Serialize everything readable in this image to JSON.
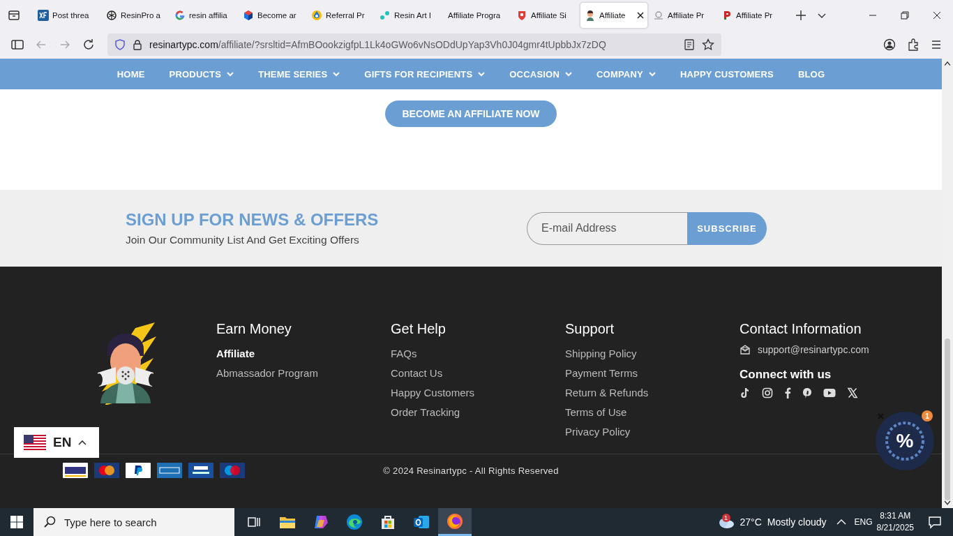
{
  "browser": {
    "tabs": [
      {
        "label": "Post threa",
        "selected": false
      },
      {
        "label": "ResinPro a",
        "selected": false
      },
      {
        "label": "resin affilia",
        "selected": false
      },
      {
        "label": "Become ar",
        "selected": false
      },
      {
        "label": "Referral Pr",
        "selected": false
      },
      {
        "label": "Resin Art I",
        "selected": false
      },
      {
        "label": "Affiliate Progra",
        "selected": false
      },
      {
        "label": "Affiliate Si",
        "selected": false
      },
      {
        "label": "Affiliate",
        "selected": true
      },
      {
        "label": "Affiliate Pr",
        "selected": false
      },
      {
        "label": "Affiliate Pr",
        "selected": false
      }
    ],
    "url_host": "resinartypc.com",
    "url_path": "/affiliate/?srsltid=AfmBOookzigfpL1Lk4oGWo6vNsODdUpYap3Vh0J04gmr4tUpbbJx7zDQ"
  },
  "nav": {
    "items": [
      {
        "label": "HOME",
        "dropdown": false
      },
      {
        "label": "PRODUCTS",
        "dropdown": true
      },
      {
        "label": "THEME SERIES",
        "dropdown": true
      },
      {
        "label": "GIFTS FOR RECIPIENTS",
        "dropdown": true
      },
      {
        "label": "OCCASION",
        "dropdown": true
      },
      {
        "label": "COMPANY",
        "dropdown": true
      },
      {
        "label": "HAPPY CUSTOMERS",
        "dropdown": false
      },
      {
        "label": "BLOG",
        "dropdown": false
      }
    ]
  },
  "cta": {
    "label": "BECOME AN AFFILIATE NOW"
  },
  "signup": {
    "title": "SIGN UP FOR NEWS & OFFERS",
    "subtitle": "Join Our Community List And Get Exciting Offers",
    "email": {
      "placeholder": "E-mail Address"
    },
    "button": "SUBSCRIBE"
  },
  "footer": {
    "columns": [
      {
        "title": "Earn Money",
        "links": [
          {
            "label": "Affiliate",
            "selected": true
          },
          {
            "label": "Abmassador Program",
            "selected": false
          }
        ]
      },
      {
        "title": "Get Help",
        "links": [
          {
            "label": "FAQs",
            "selected": false
          },
          {
            "label": "Contact Us",
            "selected": false
          },
          {
            "label": "Happy Customers",
            "selected": false
          },
          {
            "label": "Order Tracking",
            "selected": false
          }
        ]
      },
      {
        "title": "Support",
        "links": [
          {
            "label": "Shipping Policy",
            "selected": false
          },
          {
            "label": "Payment Terms",
            "selected": false
          },
          {
            "label": "Return & Refunds",
            "selected": false
          },
          {
            "label": "Terms of Use",
            "selected": false
          },
          {
            "label": "Privacy Policy",
            "selected": false
          }
        ]
      }
    ],
    "contact": {
      "title": "Contact Information",
      "email": "support@resinartypc.com",
      "connect_title": "Connect with us",
      "socials": [
        {
          "kind": "tiktok"
        },
        {
          "kind": "instagram"
        },
        {
          "kind": "facebook"
        },
        {
          "kind": "pinterest"
        },
        {
          "kind": "youtube"
        },
        {
          "kind": "x"
        }
      ]
    },
    "payments": [
      {
        "kind": "visa"
      },
      {
        "kind": "mastercard"
      },
      {
        "kind": "paypal"
      },
      {
        "kind": "amex"
      },
      {
        "kind": "electron"
      },
      {
        "kind": "maestro"
      }
    ],
    "copyright": "© 2024 Resinartypc - All Rights Reserved"
  },
  "language": {
    "code": "EN"
  },
  "discount": {
    "symbol": "%",
    "count": "1"
  },
  "taskbar": {
    "search_placeholder": "Type here to search",
    "apps": [
      {
        "kind": "taskview",
        "selected": false
      },
      {
        "kind": "explorer",
        "selected": false
      },
      {
        "kind": "copilot",
        "selected": false
      },
      {
        "kind": "edge",
        "selected": false
      },
      {
        "kind": "store",
        "selected": false
      },
      {
        "kind": "outlook",
        "selected": false
      },
      {
        "kind": "firefox",
        "selected": true
      }
    ],
    "weather_badge": "1",
    "temperature": "27°C",
    "condition": "Mostly cloudy",
    "input_lang": "ENG",
    "time": "8:31 AM",
    "date": "8/21/2025"
  }
}
